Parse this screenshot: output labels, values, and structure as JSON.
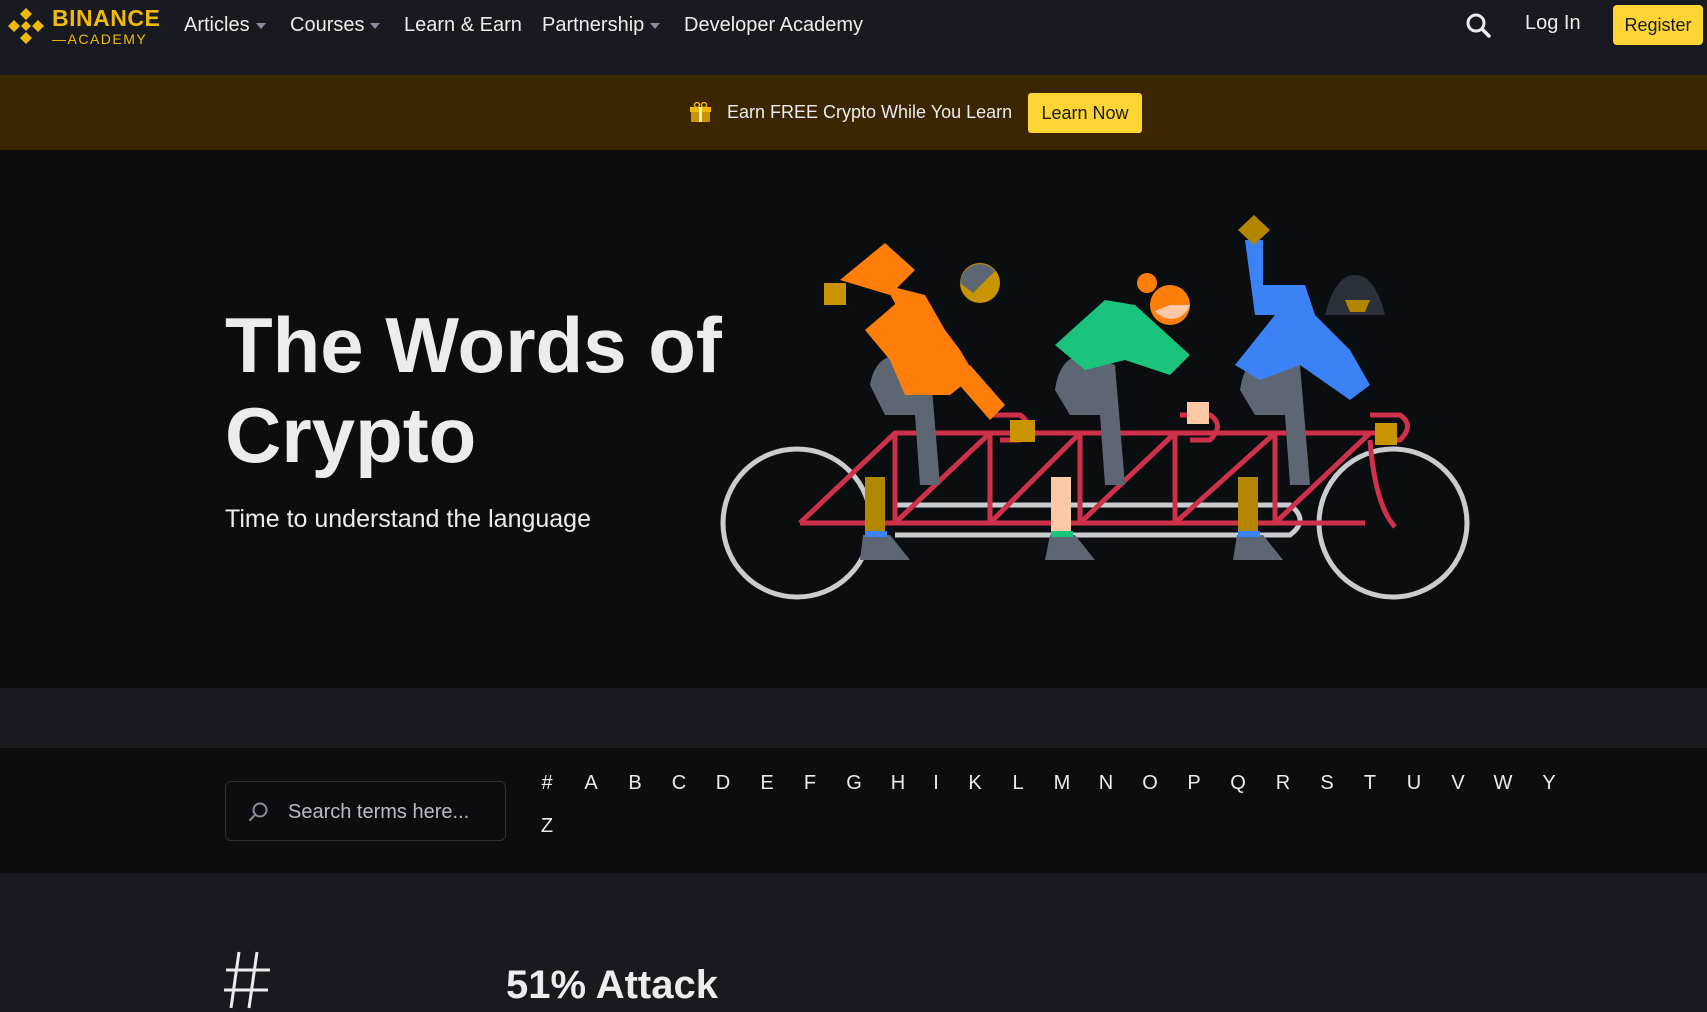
{
  "nav": {
    "logo": {
      "brand": "BINANCE",
      "sub": "ACADEMY",
      "icon": "binance-diamond-icon"
    },
    "items": [
      {
        "label": "Articles",
        "has_dropdown": true
      },
      {
        "label": "Courses",
        "has_dropdown": true
      },
      {
        "label": "Learn & Earn",
        "has_dropdown": false
      },
      {
        "label": "Partnership",
        "has_dropdown": true
      },
      {
        "label": "Developer Academy",
        "has_dropdown": false
      }
    ],
    "search_icon": "search-icon",
    "login_label": "Log In",
    "register_label": "Register"
  },
  "promo": {
    "icon": "gift-icon",
    "text": "Earn FREE Crypto While You Learn",
    "button_label": "Learn Now"
  },
  "hero": {
    "title": "The Words of Crypto",
    "subtitle": "Time to understand the language",
    "illustration": "tandem-bicycle-illustration"
  },
  "glossary": {
    "search_placeholder": "Search terms here...",
    "letters": [
      "#",
      "A",
      "B",
      "C",
      "D",
      "E",
      "F",
      "G",
      "H",
      "I",
      "K",
      "L",
      "M",
      "N",
      "O",
      "P",
      "Q",
      "R",
      "S",
      "T",
      "U",
      "V",
      "W",
      "Y",
      "Z"
    ]
  },
  "section": {
    "heading_symbol": "#",
    "first_term": "51% Attack"
  },
  "colors": {
    "brand_yellow": "#fcd535",
    "nav_bg": "#181a20",
    "promo_bg": "#3c2601",
    "hero_bg": "#0b0e11",
    "text": "#eaecef"
  }
}
